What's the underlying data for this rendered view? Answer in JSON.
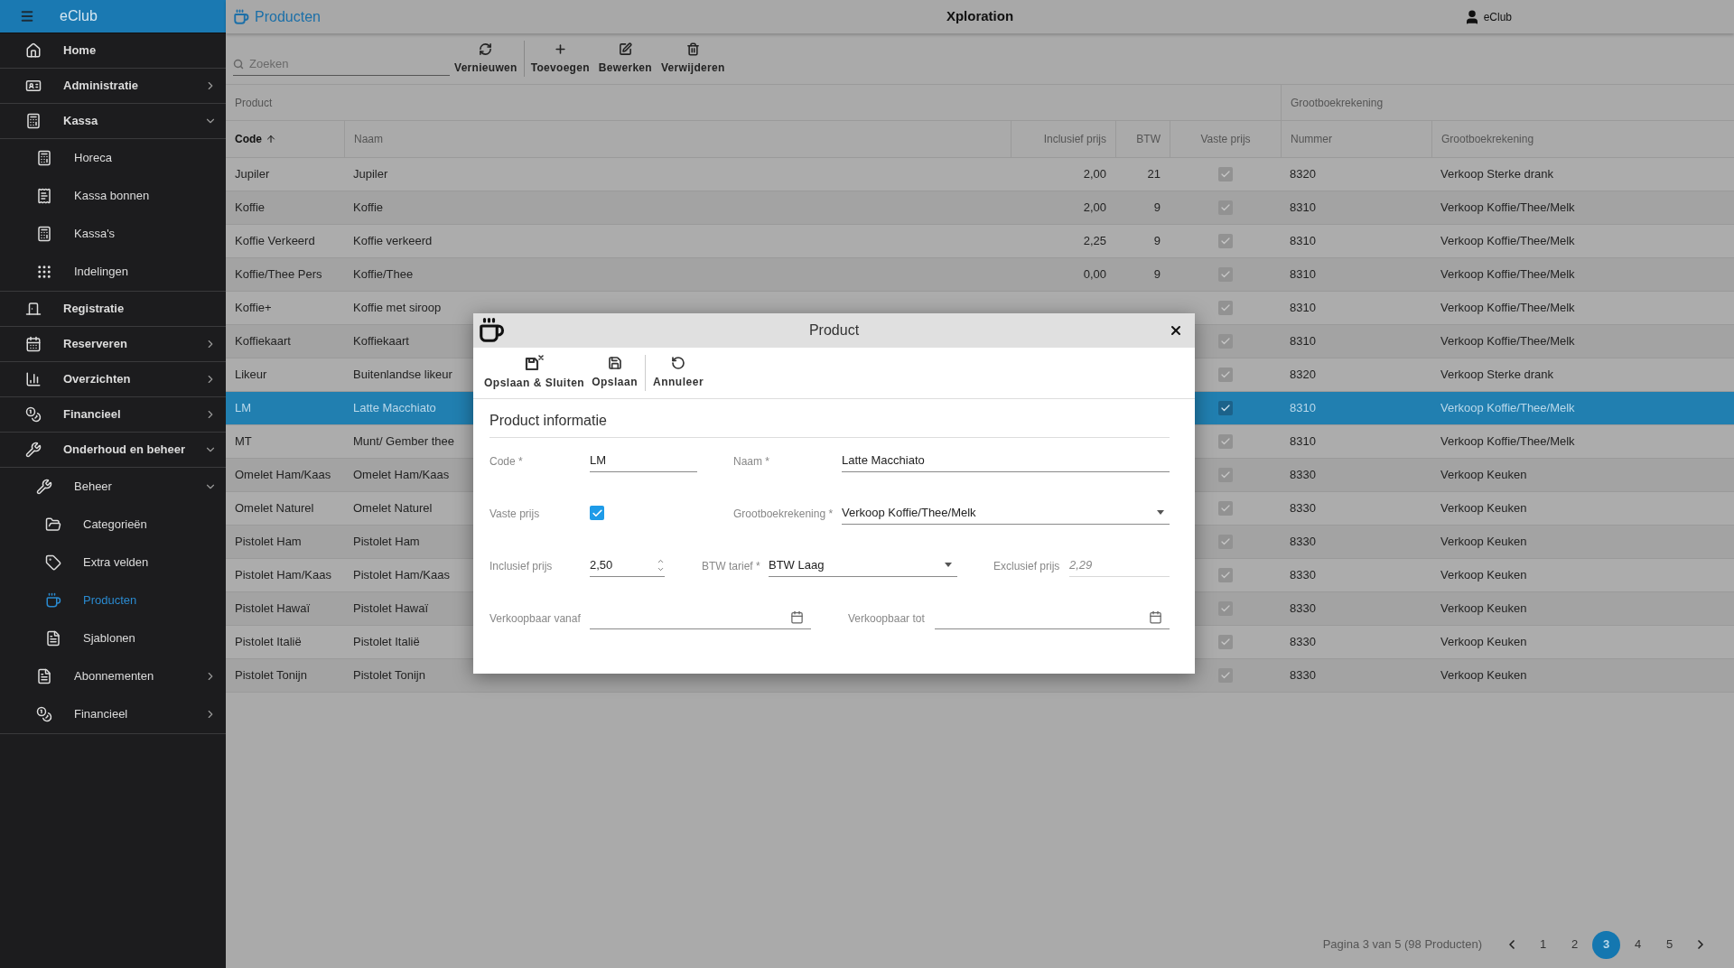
{
  "app": {
    "name": "eClub"
  },
  "topbar": {
    "page_title": "Producten",
    "center_title": "Xploration",
    "user": "eClub"
  },
  "sidebar": {
    "items": [
      {
        "label": "Home",
        "kind": "link",
        "selected": false
      },
      {
        "label": "Administratie",
        "kind": "group",
        "expanded": false,
        "selected": false
      },
      {
        "label": "Kassa",
        "kind": "group",
        "expanded": true,
        "selected": false,
        "children": [
          {
            "label": "Horeca",
            "kind": "link",
            "selected": false
          },
          {
            "label": "Kassa bonnen",
            "kind": "link",
            "selected": false
          },
          {
            "label": "Kassa's",
            "kind": "link",
            "selected": false
          },
          {
            "label": "Indelingen",
            "kind": "link",
            "selected": false
          }
        ]
      },
      {
        "label": "Registratie",
        "kind": "link",
        "selected": false
      },
      {
        "label": "Reserveren",
        "kind": "group",
        "expanded": false,
        "selected": false
      },
      {
        "label": "Overzichten",
        "kind": "group",
        "expanded": false,
        "selected": false
      },
      {
        "label": "Financieel",
        "kind": "group",
        "expanded": false,
        "selected": false
      },
      {
        "label": "Onderhoud en beheer",
        "kind": "group",
        "expanded": true,
        "selected": false,
        "children": [
          {
            "label": "Beheer",
            "kind": "group",
            "expanded": true,
            "selected": false,
            "children": [
              {
                "label": "Categorieën",
                "kind": "link",
                "selected": false
              },
              {
                "label": "Extra velden",
                "kind": "link",
                "selected": false
              },
              {
                "label": "Producten",
                "kind": "link",
                "selected": true
              },
              {
                "label": "Sjablonen",
                "kind": "link",
                "selected": false
              }
            ]
          },
          {
            "label": "Abonnementen",
            "kind": "group",
            "expanded": false,
            "selected": false
          },
          {
            "label": "Financieel",
            "kind": "group",
            "expanded": false,
            "selected": false
          }
        ]
      }
    ]
  },
  "toolbar": {
    "search": {
      "placeholder": "Zoeken"
    },
    "buttons": [
      "Vernieuwen",
      "Toevoegen",
      "Bewerken",
      "Verwijderen"
    ]
  },
  "table": {
    "group_headers": [
      "Product",
      "Grootboekrekening"
    ],
    "columns": [
      {
        "label": "Code",
        "sorted": true
      },
      {
        "label": "Naam",
        "sorted": false
      },
      {
        "label": "Inclusief prijs",
        "sorted": false
      },
      {
        "label": "BTW",
        "sorted": false
      },
      {
        "label": "Vaste prijs",
        "sorted": false
      },
      {
        "label": "Nummer",
        "sorted": false
      },
      {
        "label": "Grootboekrekening",
        "sorted": false
      }
    ],
    "rows": [
      {
        "code": "Jupiler",
        "naam": "Jupiler",
        "price": "2,00",
        "btw": "21",
        "fixed": true,
        "nummer": "8320",
        "account": "Verkoop Sterke drank",
        "selected": false
      },
      {
        "code": "Koffie",
        "naam": "Koffie",
        "price": "2,00",
        "btw": "9",
        "fixed": true,
        "nummer": "8310",
        "account": "Verkoop Koffie/Thee/Melk",
        "selected": false
      },
      {
        "code": "Koffie Verkeerd",
        "naam": "Koffie verkeerd",
        "price": "2,25",
        "btw": "9",
        "fixed": true,
        "nummer": "8310",
        "account": "Verkoop Koffie/Thee/Melk",
        "selected": false
      },
      {
        "code": "Koffie/Thee Pers",
        "naam": "Koffie/Thee",
        "price": "0,00",
        "btw": "9",
        "fixed": true,
        "nummer": "8310",
        "account": "Verkoop Koffie/Thee/Melk",
        "selected": false
      },
      {
        "code": "Koffie+",
        "naam": "Koffie met siroop",
        "fixed": true,
        "nummer": "8310",
        "account": "Verkoop Koffie/Thee/Melk",
        "selected": false
      },
      {
        "code": "Koffiekaart",
        "naam": "Koffiekaart",
        "fixed": true,
        "nummer": "8310",
        "account": "Verkoop Koffie/Thee/Melk",
        "selected": false
      },
      {
        "code": "Likeur",
        "naam": "Buitenlandse likeur",
        "fixed": true,
        "nummer": "8320",
        "account": "Verkoop Sterke drank",
        "selected": false
      },
      {
        "code": "LM",
        "naam": "Latte Macchiato",
        "fixed": true,
        "nummer": "8310",
        "account": "Verkoop Koffie/Thee/Melk",
        "selected": true
      },
      {
        "code": "MT",
        "naam": "Munt/ Gember thee",
        "fixed": true,
        "nummer": "8310",
        "account": "Verkoop Koffie/Thee/Melk",
        "selected": false
      },
      {
        "code": "Omelet Ham/Kaas",
        "naam": "Omelet Ham/Kaas",
        "fixed": true,
        "nummer": "8330",
        "account": "Verkoop Keuken",
        "selected": false
      },
      {
        "code": "Omelet Naturel",
        "naam": "Omelet Naturel",
        "fixed": true,
        "nummer": "8330",
        "account": "Verkoop Keuken",
        "selected": false
      },
      {
        "code": "Pistolet Ham",
        "naam": "Pistolet Ham",
        "fixed": true,
        "nummer": "8330",
        "account": "Verkoop Keuken",
        "selected": false
      },
      {
        "code": "Pistolet Ham/Kaas",
        "naam": "Pistolet Ham/Kaas",
        "fixed": true,
        "nummer": "8330",
        "account": "Verkoop Keuken",
        "selected": false
      },
      {
        "code": "Pistolet Hawaï",
        "naam": "Pistolet Hawaï",
        "fixed": true,
        "nummer": "8330",
        "account": "Verkoop Keuken",
        "selected": false
      },
      {
        "code": "Pistolet Italië",
        "naam": "Pistolet Italië",
        "fixed": true,
        "nummer": "8330",
        "account": "Verkoop Keuken",
        "selected": false
      },
      {
        "code": "Pistolet Tonijn",
        "naam": "Pistolet Tonijn",
        "fixed": true,
        "nummer": "8330",
        "account": "Verkoop Keuken",
        "selected": false
      }
    ]
  },
  "pagination": {
    "summary": "Pagina 3 van 5 (98 Producten)",
    "pages": [
      {
        "label": "1",
        "selected": false
      },
      {
        "label": "2",
        "selected": false
      },
      {
        "label": "3",
        "selected": true
      },
      {
        "label": "4",
        "selected": false
      },
      {
        "label": "5",
        "selected": false
      }
    ]
  },
  "dialog": {
    "title": "Product",
    "toolbar": [
      {
        "label": "Opslaan & Sluiten",
        "kind": "save-close"
      },
      {
        "label": "Opslaan",
        "kind": "save"
      },
      {
        "label": "Annuleer",
        "kind": "undo"
      }
    ],
    "section": "Product informatie",
    "rows": [
      [
        {
          "label": "Code *",
          "kind": "text",
          "value": "LM"
        },
        {
          "label": "Naam *",
          "kind": "text",
          "value": "Latte Macchiato"
        }
      ],
      [
        {
          "label": "Vaste prijs",
          "kind": "checkbox",
          "checked": true
        },
        {
          "label": "Grootboekrekening *",
          "kind": "select",
          "value": "Verkoop Koffie/Thee/Melk"
        }
      ],
      [
        {
          "label": "Inclusief prijs",
          "kind": "number",
          "value": "2,50"
        },
        {
          "label": "BTW tarief *",
          "kind": "select",
          "value": "BTW Laag"
        },
        {
          "label": "Exclusief prijs",
          "kind": "readonly",
          "value": "2,29"
        }
      ],
      [
        {
          "label": "Verkoopbaar vanaf",
          "kind": "date"
        },
        {
          "label": "Verkoopbaar tot",
          "kind": "date"
        }
      ]
    ]
  }
}
